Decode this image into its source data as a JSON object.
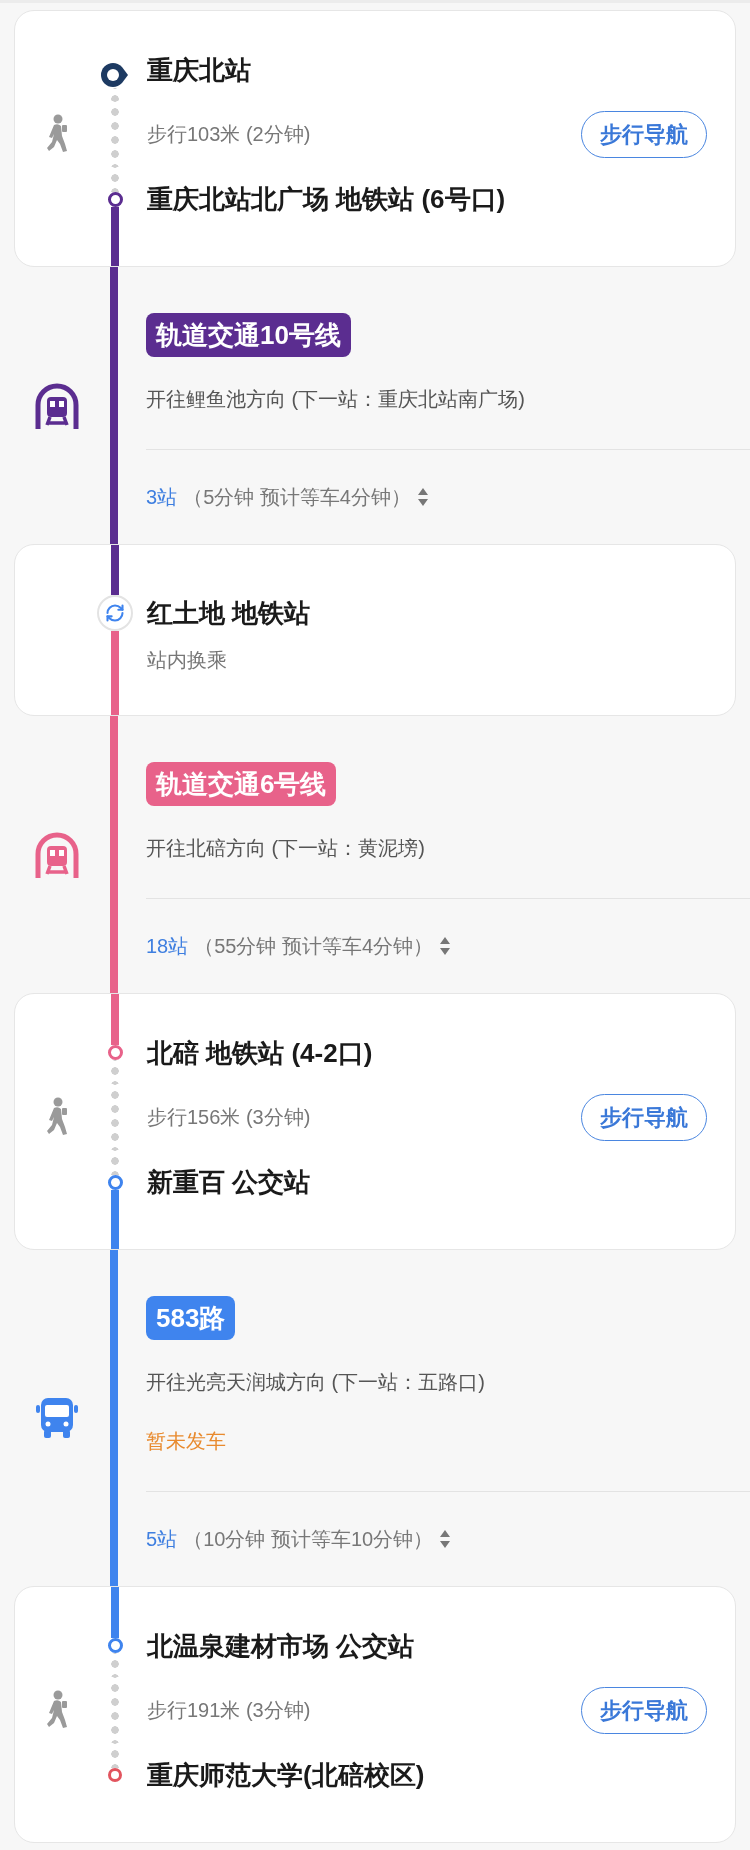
{
  "segments": [
    {
      "kind": "walk",
      "from": {
        "name": "重庆北站",
        "kind": "start"
      },
      "info": "步行103米 (2分钟)",
      "button": "步行导航",
      "to": {
        "name": "重庆北站北广场 地铁站 (6号口)",
        "kind": "stop"
      }
    },
    {
      "kind": "subway",
      "color": "#5b2d90",
      "badge": "轨道交通10号线",
      "direction": "开往鲤鱼池方向 (下一站：重庆北站南广场)",
      "stops": "3站",
      "detail": "（5分钟 预计等车4分钟）"
    },
    {
      "kind": "transfer",
      "name": "红土地 地铁站",
      "note": "站内换乘"
    },
    {
      "kind": "subway",
      "color": "#e8628a",
      "badge": "轨道交通6号线",
      "direction": "开往北碚方向 (下一站：黄泥塝)",
      "stops": "18站",
      "detail": "（55分钟 预计等车4分钟）"
    },
    {
      "kind": "walk",
      "from": {
        "name": "北碚 地铁站 (4-2口)",
        "kind": "stop"
      },
      "info": "步行156米 (3分钟)",
      "button": "步行导航",
      "to": {
        "name": "新重百 公交站",
        "kind": "stop"
      }
    },
    {
      "kind": "bus",
      "color": "#3f84ee",
      "badge": "583路",
      "direction": "开往光亮天润城方向 (下一站：五路口)",
      "status": "暂未发车",
      "stops": "5站",
      "detail": "（10分钟 预计等车10分钟）"
    },
    {
      "kind": "walk",
      "from": {
        "name": "北温泉建材市场 公交站",
        "kind": "stop"
      },
      "info": "步行191米 (3分钟)",
      "button": "步行导航",
      "to": {
        "name": "重庆师范大学(北碚校区)",
        "kind": "end"
      }
    }
  ]
}
